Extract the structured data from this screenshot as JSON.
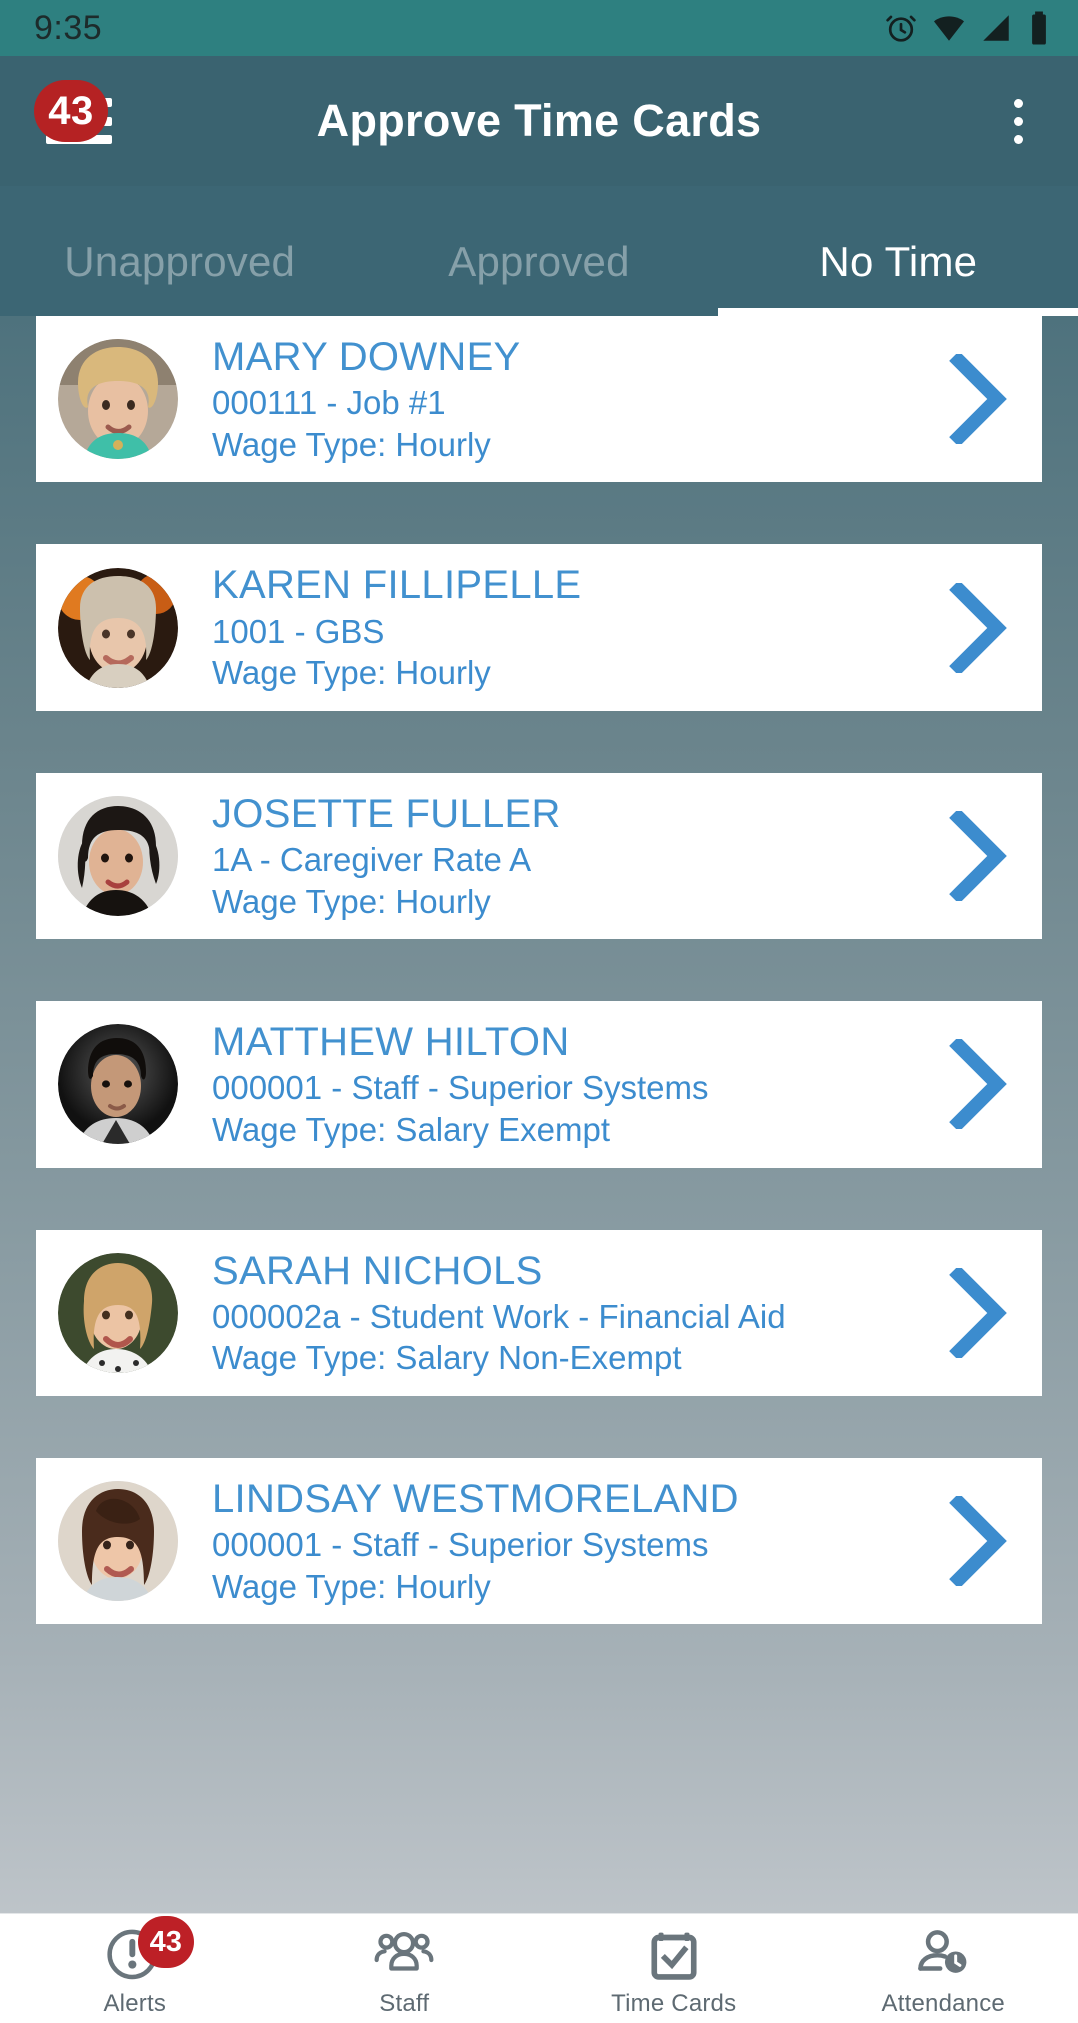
{
  "status_bar": {
    "time": "9:35",
    "icons": [
      "alarm-icon",
      "wifi-icon",
      "signal-icon",
      "battery-icon"
    ],
    "bg_color": "#2e8080"
  },
  "app_bar": {
    "title": "Approve Time Cards",
    "menu_badge_count": "43",
    "menu_icon": "hamburger-menu-icon",
    "overflow_icon": "more-vertical-icon",
    "bg_color": "#3a6370",
    "badge_color": "#b52223"
  },
  "tabs": {
    "items": [
      {
        "label": "Unapproved",
        "active": false
      },
      {
        "label": "Approved",
        "active": false
      },
      {
        "label": "No Time",
        "active": true
      }
    ],
    "indicator_color": "#ffffff"
  },
  "list": {
    "accent_color": "#3c8cce",
    "chevron_icon": "chevron-right-icon",
    "employees": [
      {
        "name": "MARY DOWNEY",
        "detail": "000111 - Job #1",
        "wage": "Wage Type: Hourly",
        "avatar": "photo-mary-downey"
      },
      {
        "name": "KAREN FILLIPELLE",
        "detail": "1001 - GBS",
        "wage": "Wage Type: Hourly",
        "avatar": "photo-karen-fillipelle"
      },
      {
        "name": "JOSETTE FULLER",
        "detail": "1A - Caregiver Rate A",
        "wage": "Wage Type: Hourly",
        "avatar": "photo-josette-fuller"
      },
      {
        "name": "MATTHEW HILTON",
        "detail": "000001 - Staff - Superior Systems",
        "wage": "Wage Type: Salary Exempt",
        "avatar": "photo-matthew-hilton"
      },
      {
        "name": "SARAH NICHOLS",
        "detail": "000002a - Student Work - Financial Aid",
        "wage": "Wage Type: Salary Non-Exempt",
        "avatar": "photo-sarah-nichols"
      },
      {
        "name": "LINDSAY WESTMORELAND",
        "detail": "000001 - Staff - Superior Systems",
        "wage": "Wage Type: Hourly",
        "avatar": "photo-lindsay-westmoreland"
      }
    ]
  },
  "bottom_nav": {
    "items": [
      {
        "label": "Alerts",
        "icon": "alert-circle-icon",
        "badge": "43"
      },
      {
        "label": "Staff",
        "icon": "people-group-icon",
        "badge": ""
      },
      {
        "label": "Time Cards",
        "icon": "calendar-check-icon",
        "badge": ""
      },
      {
        "label": "Attendance",
        "icon": "person-clock-icon",
        "badge": ""
      }
    ],
    "icon_color": "#5e6a72",
    "badge_color": "#bd2026"
  }
}
